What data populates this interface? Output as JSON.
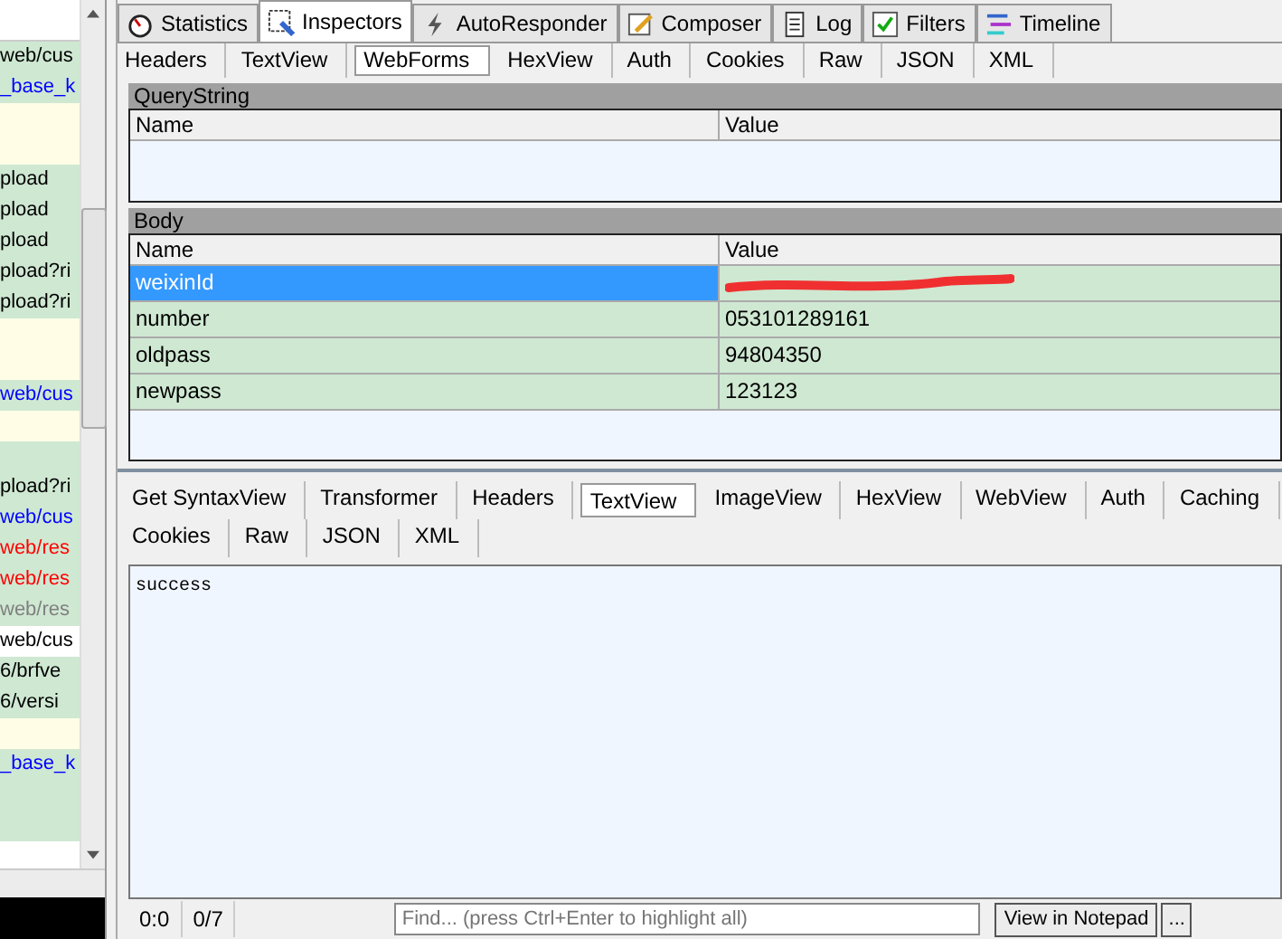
{
  "sessions": [
    {
      "text": "web/cus",
      "color": "#000000",
      "kind": "done"
    },
    {
      "text": "_base_k",
      "color": "#0000ff",
      "kind": "done"
    },
    {
      "kind": "pending"
    },
    {
      "kind": "pending"
    },
    {
      "text": "pload",
      "color": "#000000",
      "kind": "done"
    },
    {
      "text": "pload",
      "color": "#000000",
      "kind": "done"
    },
    {
      "text": "pload",
      "color": "#000000",
      "kind": "done"
    },
    {
      "text": "pload?ri",
      "color": "#000000",
      "kind": "done"
    },
    {
      "text": "pload?ri",
      "color": "#000000",
      "kind": "done"
    },
    {
      "kind": "pending"
    },
    {
      "kind": "pending"
    },
    {
      "text": "web/cus",
      "color": "#0000ff",
      "kind": "done"
    },
    {
      "kind": "pending"
    },
    {
      "kind": "done"
    },
    {
      "text": "pload?ri",
      "color": "#000000",
      "kind": "done"
    },
    {
      "text": "web/cus",
      "color": "#0000ff",
      "kind": "done"
    },
    {
      "text": "web/res",
      "color": "#ff0000",
      "kind": "done"
    },
    {
      "text": "web/res",
      "color": "#ff0000",
      "kind": "done"
    },
    {
      "text": "web/res",
      "color": "#808080",
      "kind": "done"
    },
    {
      "text": "web/cus",
      "color": "#000000",
      "kind": "plain"
    },
    {
      "text": "6/brfve",
      "color": "#000000",
      "kind": "done"
    },
    {
      "text": "6/versi",
      "color": "#000000",
      "kind": "done"
    },
    {
      "kind": "pending"
    },
    {
      "text": "_base_k",
      "color": "#0000ff",
      "kind": "done"
    },
    {
      "kind": "done"
    },
    {
      "kind": "done"
    }
  ],
  "tabs": [
    {
      "label": "Statistics",
      "selected": false
    },
    {
      "label": "Inspectors",
      "selected": true
    },
    {
      "label": "AutoResponder",
      "selected": false
    },
    {
      "label": "Composer",
      "selected": false
    },
    {
      "label": "Log",
      "selected": false
    },
    {
      "label": "Filters",
      "selected": false
    },
    {
      "label": "Timeline",
      "selected": false
    }
  ],
  "request_tabs": [
    {
      "label": "Headers",
      "selected": false
    },
    {
      "label": "TextView",
      "selected": false
    },
    {
      "label": "WebForms",
      "selected": true
    },
    {
      "label": "HexView",
      "selected": false
    },
    {
      "label": "Auth",
      "selected": false
    },
    {
      "label": "Cookies",
      "selected": false
    },
    {
      "label": "Raw",
      "selected": false
    },
    {
      "label": "JSON",
      "selected": false
    },
    {
      "label": "XML",
      "selected": false
    }
  ],
  "query_string": {
    "title": "QueryString",
    "columns": [
      "Name",
      "Value"
    ]
  },
  "body": {
    "title": "Body",
    "columns": [
      "Name",
      "Value"
    ],
    "rows": [
      {
        "name": "weixinId",
        "redacted": true,
        "selected": true
      },
      {
        "name": "number",
        "value": "053101289161",
        "selected": false
      },
      {
        "name": "oldpass",
        "value": "94804350",
        "selected": false
      },
      {
        "name": "newpass",
        "value": "123123",
        "selected": false
      }
    ]
  },
  "response_tabs": [
    [
      {
        "label": "Get SyntaxView",
        "selected": false
      },
      {
        "label": "Transformer",
        "selected": false
      },
      {
        "label": "Headers",
        "selected": false
      },
      {
        "label": "TextView",
        "selected": true
      },
      {
        "label": "ImageView",
        "selected": false
      },
      {
        "label": "HexView",
        "selected": false
      },
      {
        "label": "WebView",
        "selected": false
      },
      {
        "label": "Auth",
        "selected": false
      },
      {
        "label": "Caching",
        "selected": false
      }
    ],
    [
      {
        "label": "Cookies",
        "selected": false
      },
      {
        "label": "Raw",
        "selected": false
      },
      {
        "label": "JSON",
        "selected": false
      },
      {
        "label": "XML",
        "selected": false
      }
    ]
  ],
  "response_text": "success",
  "status": {
    "position": "0:0",
    "count": "0/7",
    "find_placeholder": "Find... (press Ctrl+Enter to highlight all)",
    "notepad_button": "View in Notepad",
    "more_button": "..."
  }
}
